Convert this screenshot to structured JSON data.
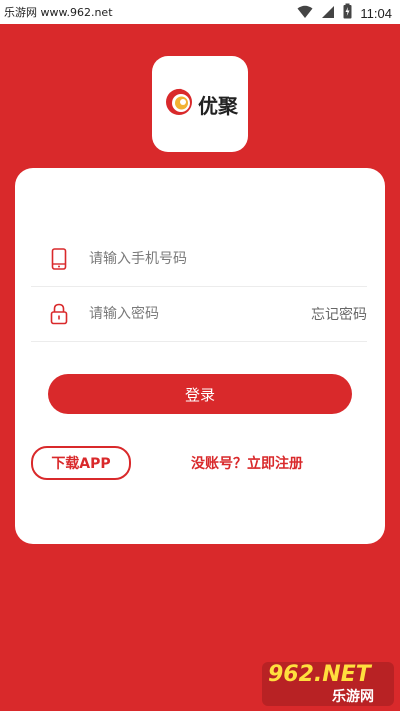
{
  "status_bar": {
    "left_text": "乐游网 www.962.net",
    "time": "11:04",
    "icons": [
      "wifi-icon",
      "signal-icon",
      "battery-charging-icon"
    ]
  },
  "logo": {
    "text": "优聚"
  },
  "login": {
    "phone_placeholder": "请输入手机号码",
    "password_placeholder": "请输入密码",
    "forgot_label": "忘记密码",
    "login_button": "登录",
    "download_button": "下载APP",
    "register_link": "没账号？立即注册"
  },
  "watermark": {
    "top_text": "962.NET",
    "bottom_text": "乐游网"
  },
  "colors": {
    "brand_red": "#d9292b",
    "card_bg": "#ffffff",
    "placeholder": "#7a7a7a"
  }
}
